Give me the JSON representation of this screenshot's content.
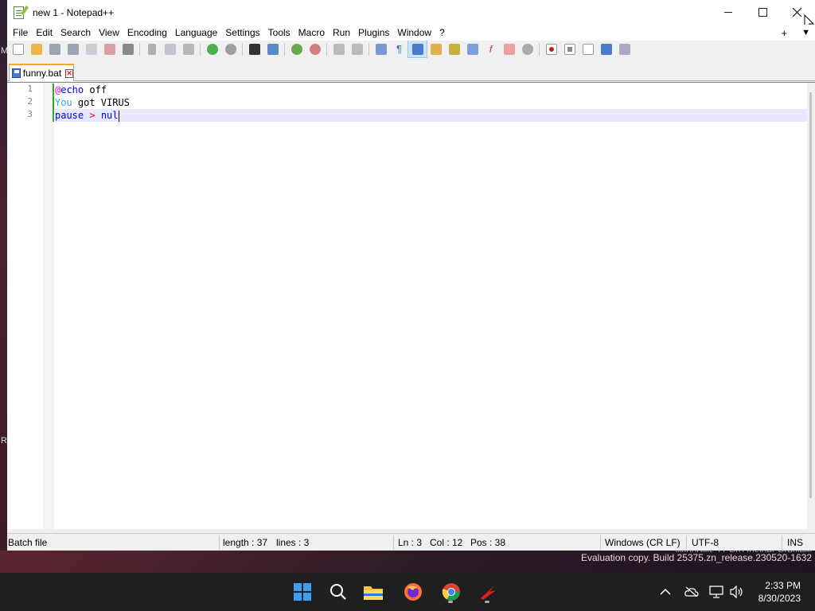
{
  "window": {
    "title": "new 1 - Notepad++"
  },
  "desktop": {
    "edge_letters": [
      "M",
      "R"
    ]
  },
  "menu": {
    "items": [
      "File",
      "Edit",
      "Search",
      "View",
      "Encoding",
      "Language",
      "Settings",
      "Tools",
      "Macro",
      "Run",
      "Plugins",
      "Window",
      "?"
    ],
    "right_plus": "+",
    "right_arrow": "▼"
  },
  "toolbar": {
    "icons": [
      "new-file-icon",
      "open-file-icon",
      "save-icon",
      "save-all-icon",
      "close-icon",
      "close-all-icon",
      "print-icon",
      "cut-icon",
      "copy-icon",
      "paste-icon",
      "undo-icon",
      "redo-icon",
      "find-icon",
      "replace-icon",
      "zoom-in-icon",
      "zoom-out-icon",
      "sync-vertical-icon",
      "sync-horizontal-icon",
      "word-wrap-icon",
      "show-all-chars-icon",
      "indent-guide-icon",
      "udl-icon",
      "doc-map-icon",
      "doc-list-icon",
      "function-list-icon",
      "folder-workspace-icon",
      "monitoring-icon",
      "record-macro-icon",
      "stop-macro-icon",
      "play-macro-icon",
      "run-macro-multiple-icon",
      "save-macro-icon"
    ]
  },
  "tab": {
    "label": "funny.bat",
    "close_glyph": "✕"
  },
  "editor": {
    "line_numbers": [
      "1",
      "2",
      "3"
    ],
    "lines": [
      {
        "tokens": [
          {
            "t": "@",
            "c": "tok-at"
          },
          {
            "t": "echo",
            "c": "tok-kw"
          },
          {
            "t": " off",
            "c": "tok-plain"
          }
        ]
      },
      {
        "tokens": [
          {
            "t": "You",
            "c": "tok-label"
          },
          {
            "t": " got VIRUS",
            "c": "tok-plain"
          }
        ]
      },
      {
        "tokens": [
          {
            "t": "pause",
            "c": "tok-kw"
          },
          {
            "t": " ",
            "c": "tok-plain"
          },
          {
            "t": ">",
            "c": "tok-op"
          },
          {
            "t": " ",
            "c": "tok-plain"
          },
          {
            "t": "nul",
            "c": "tok-kw"
          }
        ]
      }
    ],
    "current_line": 3
  },
  "status": {
    "file_type": "Batch file",
    "length": "length : 37",
    "lines": "lines : 3",
    "ln": "Ln : 3",
    "col": "Col : 12",
    "pos": "Pos : 38",
    "eol": "Windows (CR LF)",
    "encoding": "UTF-8",
    "mode": "INS"
  },
  "watermark": {
    "line1": "Windows 11 Pro Insider Preview",
    "line2": "Evaluation copy. Build 25375.zn_release.230520-1632"
  },
  "taskbar": {
    "time": "2:33 PM",
    "date": "8/30/2023",
    "apps": [
      "start-icon",
      "search-icon",
      "file-explorer-icon",
      "firefox-icon",
      "chrome-icon",
      "notepad-plus-plus-icon"
    ]
  },
  "colors": {
    "accent_tab": "#f9a825",
    "keyword": "#0000ff",
    "at_sign": "#ff00ff",
    "operator": "#ff0000",
    "label": "#2fa4d0",
    "current_line_bg": "#e8e8ff",
    "change_bar": "#2ea82e"
  }
}
